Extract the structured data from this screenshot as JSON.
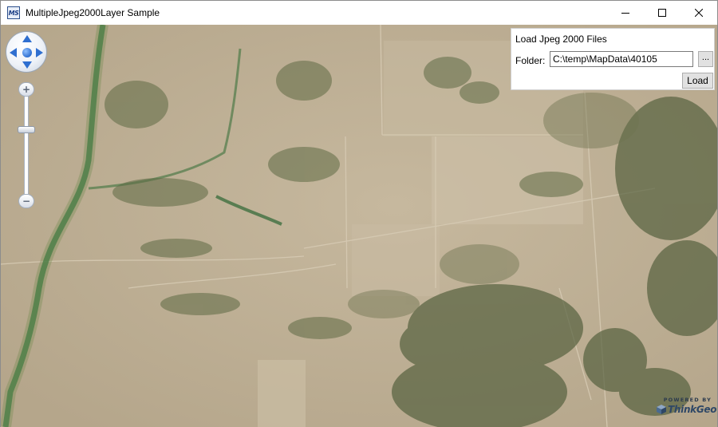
{
  "window": {
    "title": "MultipleJpeg2000Layer Sample",
    "app_icon_text": "MS",
    "controls": [
      "minimize-icon",
      "maximize-icon",
      "close-icon"
    ]
  },
  "map": {
    "pan_control": {
      "arrows": [
        "arrow-up-icon",
        "arrow-down-icon",
        "arrow-left-icon",
        "arrow-right-icon"
      ],
      "center": "pan-center-icon",
      "accent_color": "#2f6fd0"
    },
    "zoom_bar": {
      "zoom_in_label": "+",
      "zoom_out_label": "−",
      "level_fraction": 0.3
    },
    "terrain_colors": {
      "ground": "#bcae95",
      "light_ground": "#cdbfa6",
      "vegetation": "#5e6a44",
      "river": "#3e7a46"
    }
  },
  "load_panel": {
    "title": "Load Jpeg 2000 Files",
    "folder_label": "Folder:",
    "folder_value": "C:\\temp\\MapData\\40105",
    "browse_label": "...",
    "load_label": "Load"
  },
  "logo": {
    "powered_by": "POWERED BY",
    "brand": "ThinkGeo",
    "icon": "thinkgeo-cube-icon"
  }
}
